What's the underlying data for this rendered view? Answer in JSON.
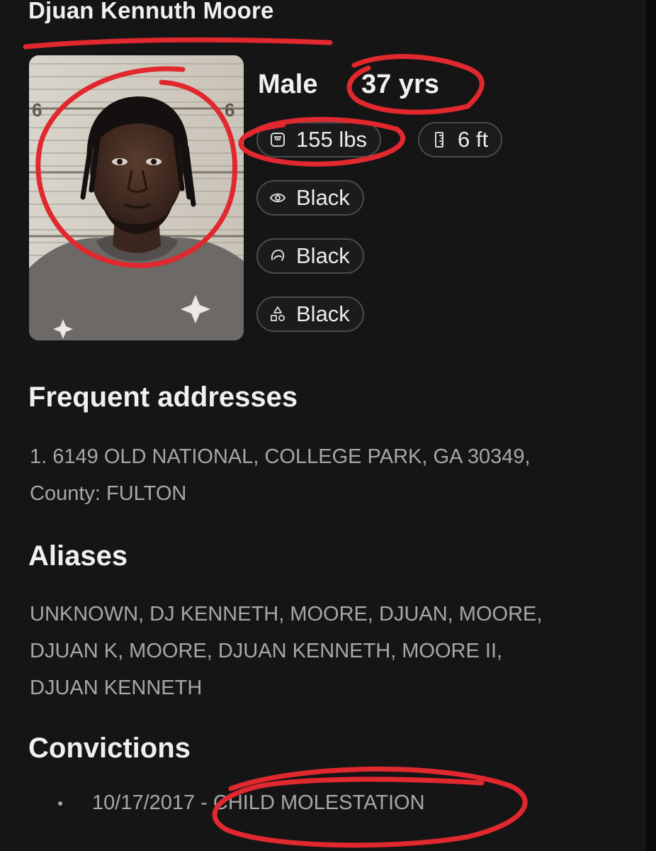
{
  "profile": {
    "name": "Djuan Kennuth Moore",
    "sex": "Male",
    "age": "37 yrs",
    "weight": "155 lbs",
    "height": "6 ft",
    "eye_color": "Black",
    "hair_color": "Black",
    "race": "Black",
    "icons": {
      "weight": "scale-icon",
      "height": "height-ruler-icon",
      "eye": "eye-icon",
      "hair": "hair-icon",
      "race": "shapes-icon"
    }
  },
  "addresses": {
    "title": "Frequent addresses",
    "line1": "1. 6149 OLD NATIONAL, COLLEGE PARK, GA 30349,",
    "line2": "County: FULTON"
  },
  "aliases": {
    "title": "Aliases",
    "line1": "UNKNOWN, DJ KENNETH, MOORE, DJUAN, MOORE,",
    "line2": "DJUAN K, MOORE, DJUAN KENNETH, MOORE II,",
    "line3": "DJUAN KENNETH"
  },
  "convictions": {
    "title": "Convictions",
    "items": [
      {
        "text": "10/17/2017 - CHILD MOLESTATION"
      }
    ]
  },
  "colors": {
    "background": "#161516",
    "annotation_red": "#e0282e",
    "muted_text": "#a7a7aa"
  }
}
